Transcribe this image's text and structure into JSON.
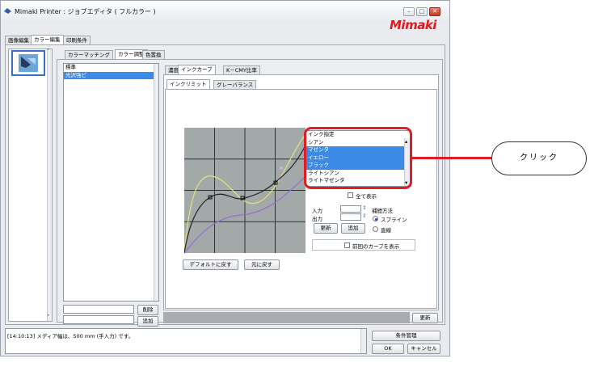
{
  "window": {
    "title": "Mimaki Printer : ジョブエディタ ( フルカラー )",
    "logo": "Mimaki",
    "minimize": "–",
    "maximize": "□",
    "close": "✕"
  },
  "main_tabs": [
    "画像編集",
    "カラー編集",
    "印刷条件"
  ],
  "color_tabs": [
    "カラーマッチング",
    "カラー調整",
    "色置換"
  ],
  "left_list": {
    "items": [
      "標準",
      "光沢強ピ"
    ],
    "selected_index": 1,
    "delete_label": "削除",
    "add_label": "追加"
  },
  "curve_tabs": [
    "濃度",
    "インクカーブ",
    "K－CMY比率"
  ],
  "sub_tabs": [
    "インクリミット",
    "グレーバランス"
  ],
  "ink": {
    "header": "インク指定",
    "items": [
      "シアン",
      "マゼンタ",
      "イエロー",
      "ブラック",
      "ライトシアン",
      "ライトマゼンタ"
    ],
    "selected": [
      1,
      2,
      3
    ],
    "show_all_label": "全て表示"
  },
  "inputs": {
    "input_label": "入力",
    "output_label": "出力",
    "update_label": "更新",
    "add_label": "追加"
  },
  "interp": {
    "label": "補間方法",
    "spline_label": "スプライン",
    "linear_label": "直線",
    "selected": "スプライン"
  },
  "show_prev_label": "前回のカーブを表示",
  "default_button": "デフォルトに戻す",
  "revert_button": "元に戻す",
  "refresh_button": "更新",
  "log_text": "[14:10:13] メディア幅は、500 mm (手入力) です。",
  "condition_button": "条件管理",
  "ok_button": "OK",
  "cancel_button": "キャンセル",
  "callout_label": "クリック",
  "colors": {
    "callout_red": "#e31b23",
    "selection_blue": "#3b8be6",
    "grid_bg": "#a3a9a9"
  }
}
